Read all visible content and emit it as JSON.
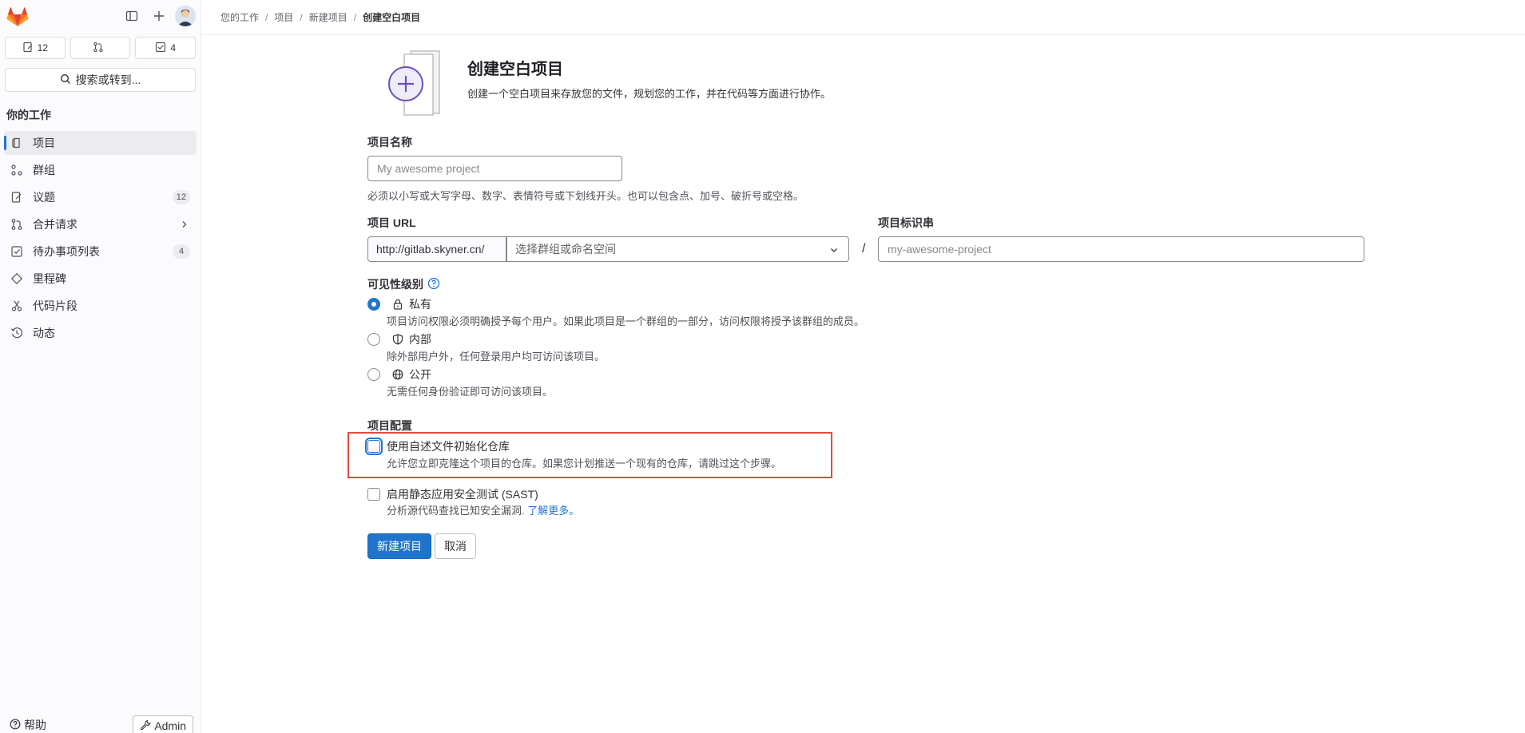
{
  "sidebar": {
    "counters": {
      "issues": "12",
      "merge_requests": "",
      "todos": "4"
    },
    "search_label": "搜索或转到...",
    "section_title": "你的工作",
    "items": [
      {
        "label": "项目",
        "icon": "project-icon"
      },
      {
        "label": "群组",
        "icon": "group-icon"
      },
      {
        "label": "议题",
        "icon": "issues-icon",
        "badge": "12"
      },
      {
        "label": "合并请求",
        "icon": "merge-request-icon"
      },
      {
        "label": "待办事项列表",
        "icon": "todo-icon",
        "badge": "4"
      },
      {
        "label": "里程碑",
        "icon": "milestone-icon"
      },
      {
        "label": "代码片段",
        "icon": "snippet-icon"
      },
      {
        "label": "动态",
        "icon": "activity-icon"
      }
    ],
    "help_label": "帮助",
    "admin_label": "Admin"
  },
  "breadcrumb": {
    "items": [
      "您的工作",
      "项目",
      "新建项目"
    ],
    "current": "创建空白项目"
  },
  "hero": {
    "title": "创建空白项目",
    "description": "创建一个空白项目来存放您的文件，规划您的工作，并在代码等方面进行协作。"
  },
  "form": {
    "name_label": "项目名称",
    "name_placeholder": "My awesome project",
    "name_help": "必须以小写或大写字母、数字、表情符号或下划线开头。也可以包含点、加号、破折号或空格。",
    "url_label": "项目 URL",
    "url_prefix": "http://gitlab.skyner.cn/",
    "namespace_placeholder": "选择群组或命名空间",
    "slash": "/",
    "slug_label": "项目标识串",
    "slug_placeholder": "my-awesome-project",
    "visibility_label": "可见性级别",
    "visibility": [
      {
        "label": "私有",
        "description": "项目访问权限必须明确授予每个用户。如果此项目是一个群组的一部分，访问权限将授予该群组的成员。",
        "checked": true
      },
      {
        "label": "内部",
        "description": "除外部用户外，任何登录用户均可访问该项目。",
        "checked": false
      },
      {
        "label": "公开",
        "description": "无需任何身份验证即可访问该项目。",
        "checked": false
      }
    ],
    "config_label": "项目配置",
    "init_readme_label": "使用自述文件初始化仓库",
    "init_readme_help": "允许您立即克隆这个项目的仓库。如果您计划推送一个现有的仓库，请跳过这个步骤。",
    "sast_label": "启用静态应用安全测试 (SAST)",
    "sast_help": "分析源代码查找已知安全漏洞.",
    "learn_more": "了解更多。",
    "submit_label": "新建项目",
    "cancel_label": "取消"
  },
  "colors": {
    "primary": "#1f75cb",
    "highlight": "#e24c3c",
    "brand": "#e24329"
  }
}
